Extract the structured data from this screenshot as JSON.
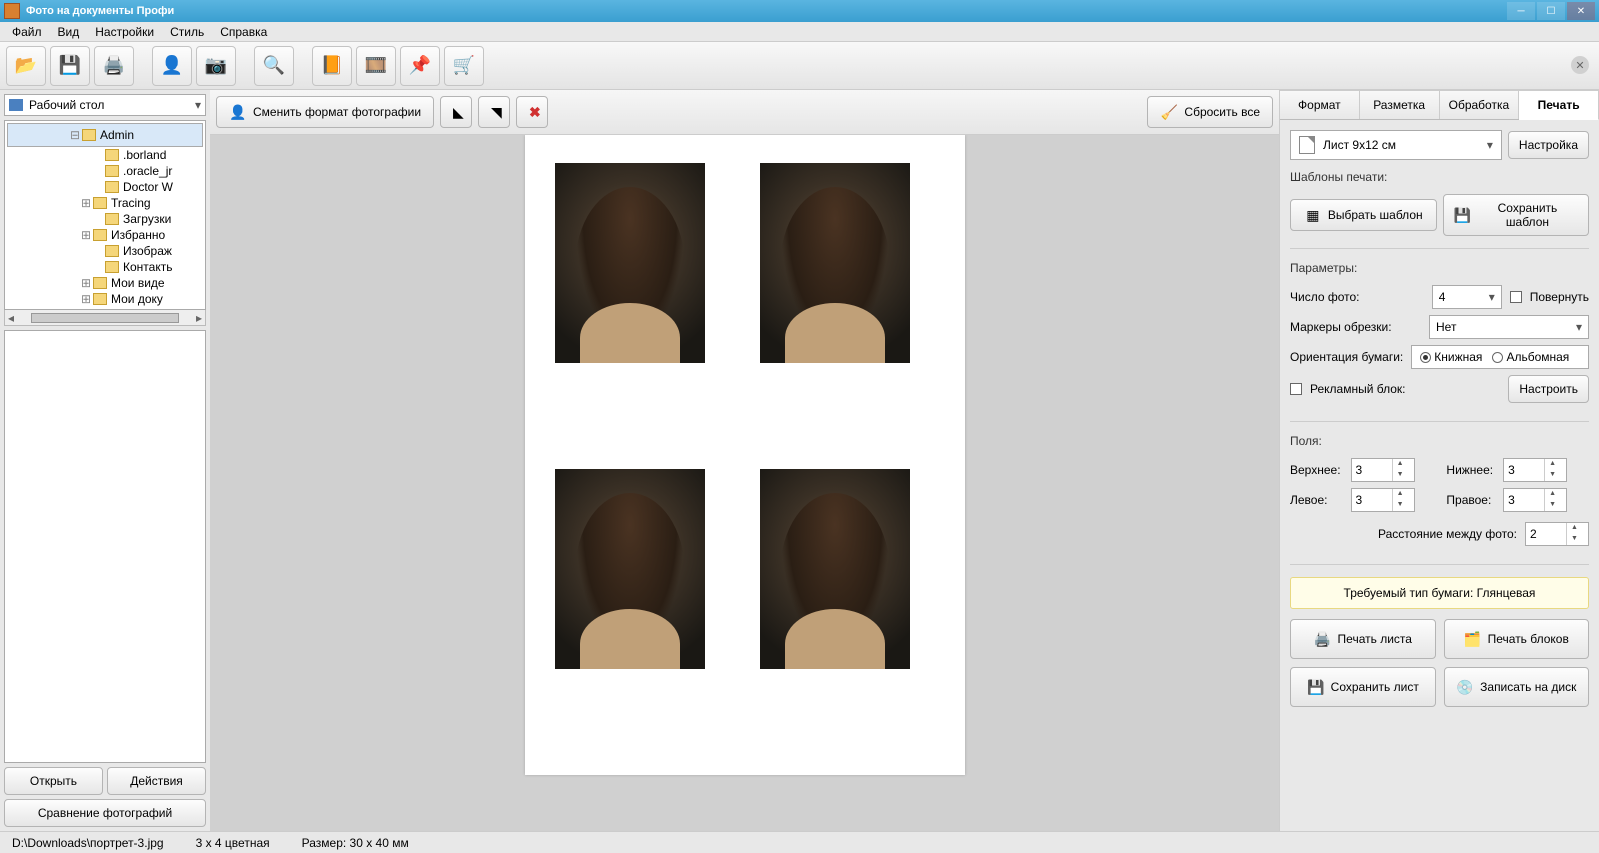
{
  "title": "Фото на документы Профи",
  "menu": [
    "Файл",
    "Вид",
    "Настройки",
    "Стиль",
    "Справка"
  ],
  "left": {
    "drive": "Рабочий стол",
    "tree": [
      {
        "indent": 5,
        "exp": "⊟",
        "label": "Admin",
        "sel": true
      },
      {
        "indent": 7,
        "exp": "",
        "label": ".borland"
      },
      {
        "indent": 7,
        "exp": "",
        "label": ".oracle_jr"
      },
      {
        "indent": 7,
        "exp": "",
        "label": "Doctor W"
      },
      {
        "indent": 6,
        "exp": "⊞",
        "label": "Tracing"
      },
      {
        "indent": 7,
        "exp": "",
        "label": "Загрузки"
      },
      {
        "indent": 6,
        "exp": "⊞",
        "label": "Избранно"
      },
      {
        "indent": 7,
        "exp": "",
        "label": "Изображ"
      },
      {
        "indent": 7,
        "exp": "",
        "label": "Контакть"
      },
      {
        "indent": 6,
        "exp": "⊞",
        "label": "Мои виде"
      },
      {
        "indent": 6,
        "exp": "⊞",
        "label": "Мои доку"
      }
    ],
    "open": "Открыть",
    "actions": "Действия",
    "compare": "Сравнение фотографий"
  },
  "center": {
    "change_format": "Сменить формат фотографии",
    "reset_all": "Сбросить все"
  },
  "right": {
    "tabs": [
      "Формат",
      "Разметка",
      "Обработка",
      "Печать"
    ],
    "active_tab": 3,
    "sheet": "Лист 9x12 см",
    "settings_btn": "Настройка",
    "templates_label": "Шаблоны печати:",
    "choose_template": "Выбрать шаблон",
    "save_template": "Сохранить шаблон",
    "params_label": "Параметры:",
    "photo_count_label": "Число фото:",
    "photo_count": "4",
    "rotate": "Повернуть",
    "crop_markers_label": "Маркеры обрезки:",
    "crop_markers": "Нет",
    "orientation_label": "Ориентация бумаги:",
    "orient_portrait": "Книжная",
    "orient_landscape": "Альбомная",
    "ad_block": "Рекламный блок:",
    "configure": "Настроить",
    "margins_label": "Поля:",
    "margin_top_l": "Верхнее:",
    "margin_top": "3",
    "margin_bottom_l": "Нижнее:",
    "margin_bottom": "3",
    "margin_left_l": "Левое:",
    "margin_left": "3",
    "margin_right_l": "Правое:",
    "margin_right": "3",
    "spacing_l": "Расстояние между фото:",
    "spacing": "2",
    "paper_note": "Требуемый тип бумаги: Глянцевая",
    "print_sheet": "Печать листа",
    "print_blocks": "Печать блоков",
    "save_sheet": "Сохранить лист",
    "burn_disc": "Записать на диск"
  },
  "status": {
    "path": "D:\\Downloads\\портрет-3.jpg",
    "color": "3 x 4 цветная",
    "size": "Размер: 30 x 40 мм"
  }
}
